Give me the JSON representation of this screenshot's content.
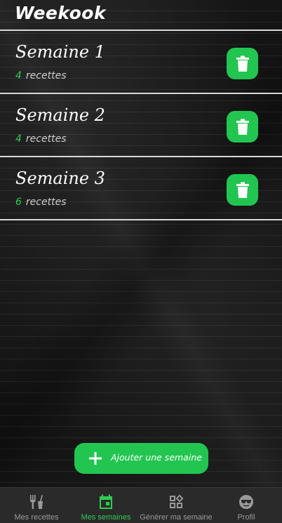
{
  "app": {
    "title": "Weekook"
  },
  "weeks": [
    {
      "title": "Semaine 1",
      "count": "4",
      "count_label": "recettes"
    },
    {
      "title": "Semaine 2",
      "count": "4",
      "count_label": "recettes"
    },
    {
      "title": "Semaine 3",
      "count": "6",
      "count_label": "recettes"
    }
  ],
  "add_button": {
    "label": "Ajouter une semaine",
    "icon": "plus-icon"
  },
  "nav": {
    "items": [
      {
        "label": "Mes recettes",
        "icon": "utensils-icon",
        "active": false
      },
      {
        "label": "Mes semaines",
        "icon": "calendar-icon",
        "active": true
      },
      {
        "label": "Générer ma semaine",
        "icon": "widgets-icon",
        "active": false
      },
      {
        "label": "Profil",
        "icon": "profile-sunglasses-icon",
        "active": false
      }
    ]
  },
  "colors": {
    "accent": "#22c550",
    "background": "#161616",
    "nav_bg": "#2a2a2a"
  }
}
